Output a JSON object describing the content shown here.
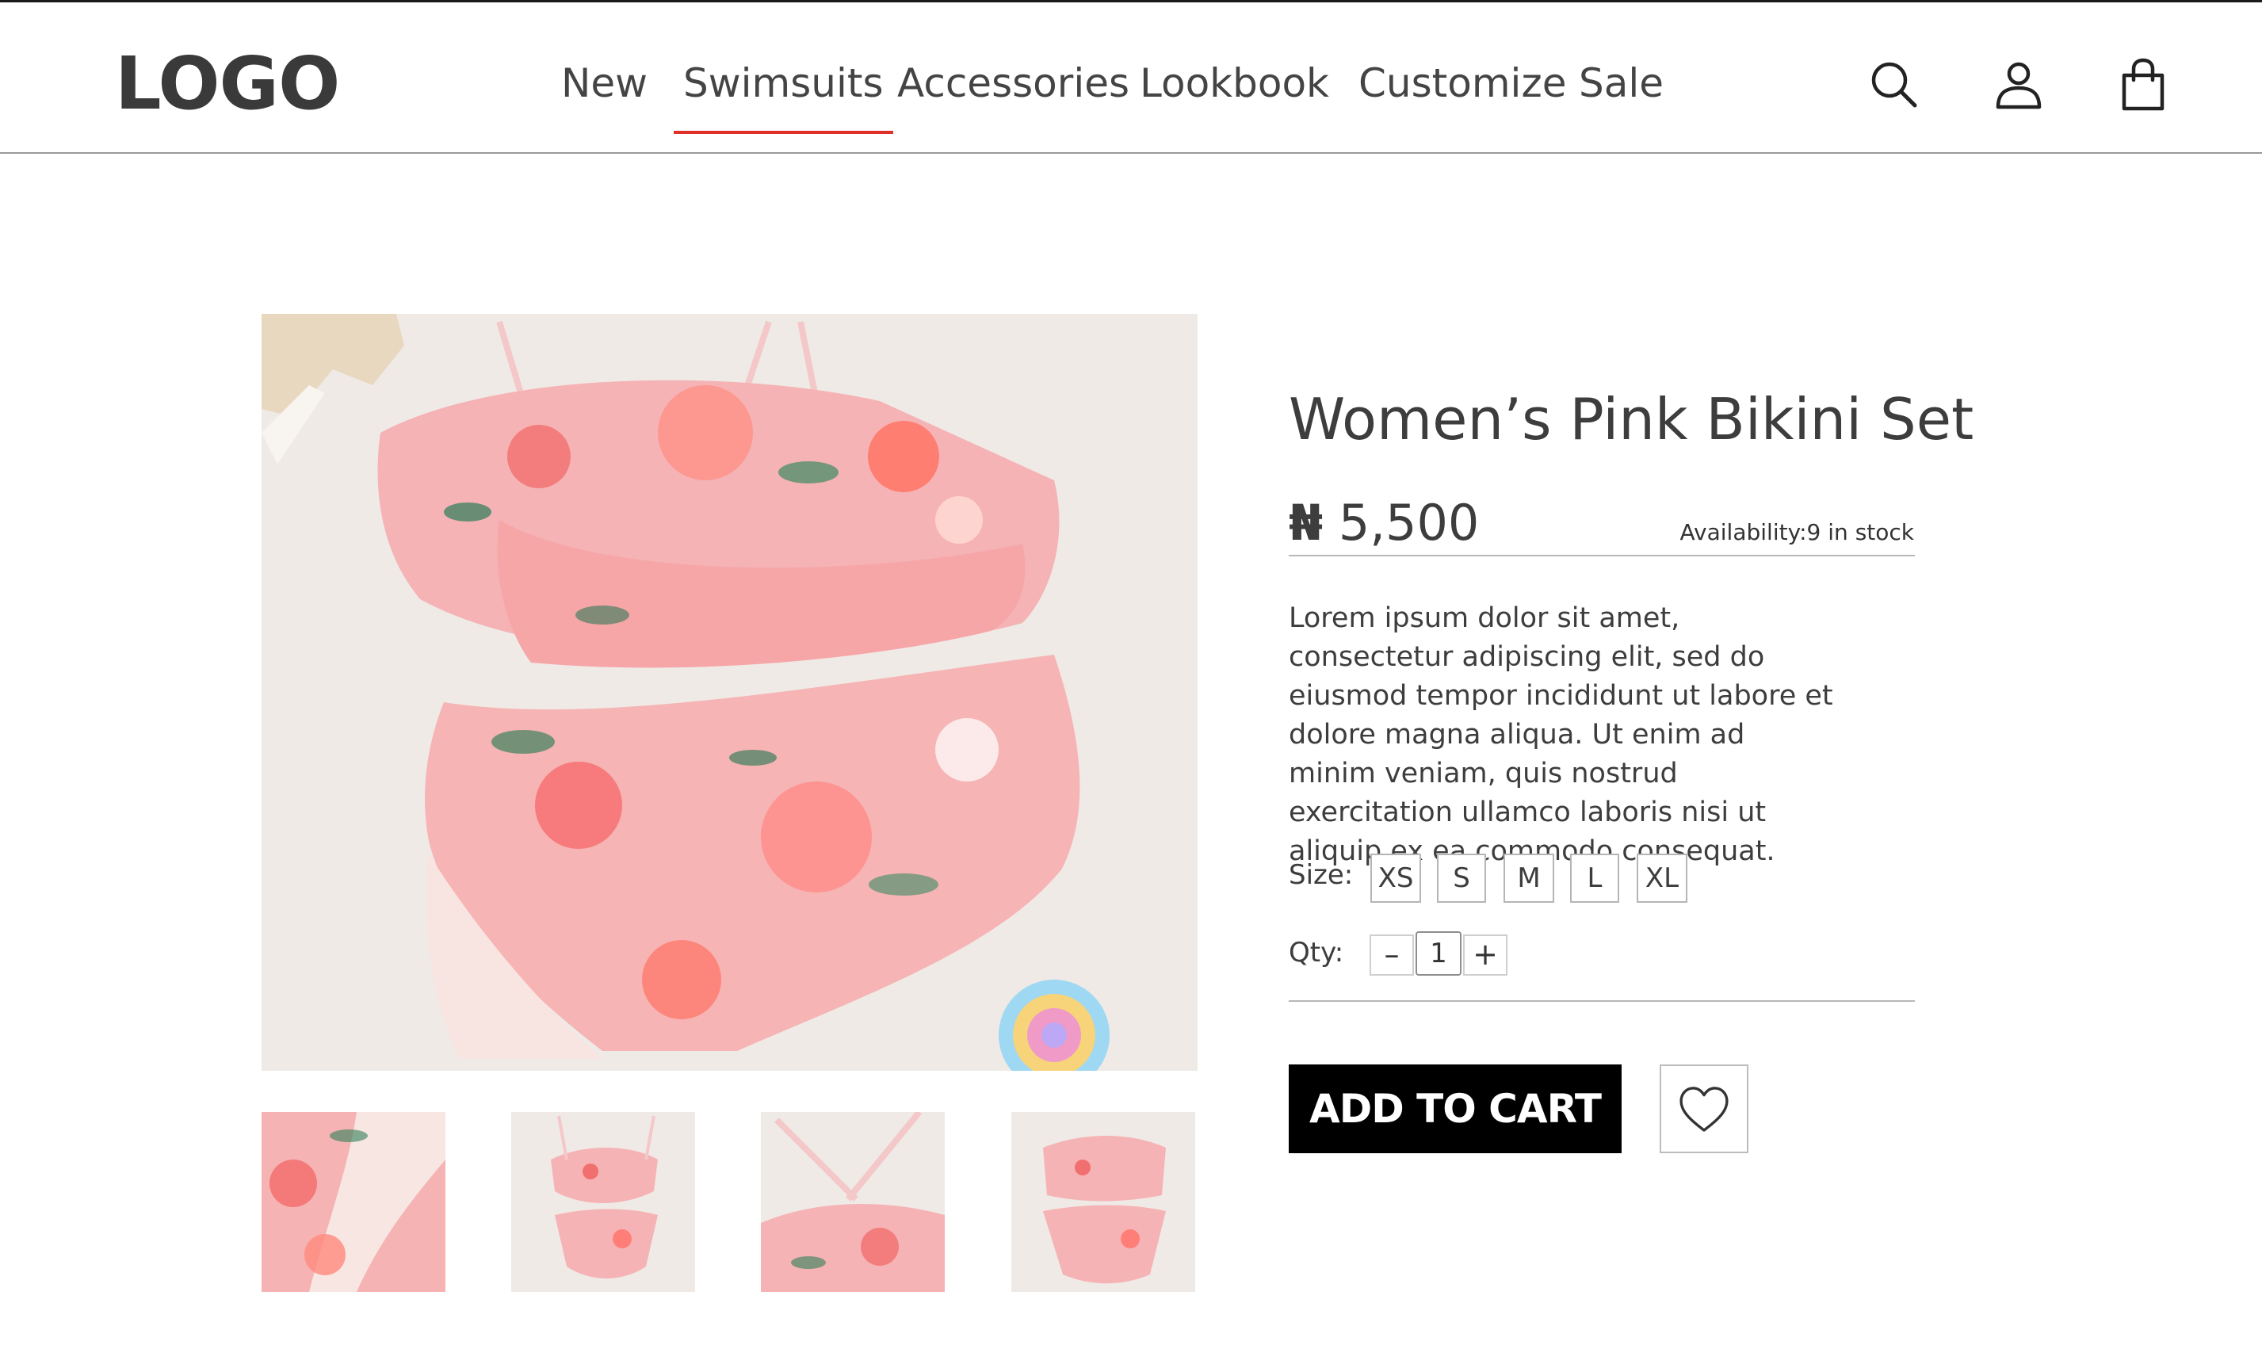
{
  "header": {
    "logo": "LOGO",
    "nav": [
      {
        "label": "New",
        "active": false
      },
      {
        "label": "Swimsuits",
        "active": true
      },
      {
        "label": "Accessories",
        "active": false
      },
      {
        "label": "Lookbook",
        "active": false
      },
      {
        "label": "Customize",
        "active": false
      },
      {
        "label": "Sale",
        "active": false
      }
    ],
    "icons": [
      "search-icon",
      "user-icon",
      "shopping-bag-icon"
    ]
  },
  "gallery": {
    "thumbnails": [
      "thumbnail-1",
      "thumbnail-2",
      "thumbnail-3",
      "thumbnail-4"
    ]
  },
  "product": {
    "title": "Women’s Pink Bikini Set",
    "currency": "₦",
    "price": "5,500",
    "availability": "Availability:9 in stock",
    "description": "Lorem ipsum dolor sit amet, consectetur adipiscing elit, sed do eiusmod tempor incididunt ut labore et dolore magna aliqua. Ut enim ad minim veniam, quis nostrud exercitation ullamco laboris nisi ut aliquip ex ea commodo consequat.",
    "size_label": "Size:",
    "sizes": [
      "XS",
      "S",
      "M",
      "L",
      "XL"
    ],
    "qty_label": "Qty:",
    "qty_minus": "–",
    "qty_value": "1",
    "qty_plus": "+",
    "add_to_cart": "ADD TO CART",
    "wishlist_icon": "heart-icon"
  },
  "colors": {
    "accent": "#e0302a",
    "button_bg": "#000000",
    "photo_bg": "#efeae6",
    "fabric": "#f7b8b8"
  }
}
